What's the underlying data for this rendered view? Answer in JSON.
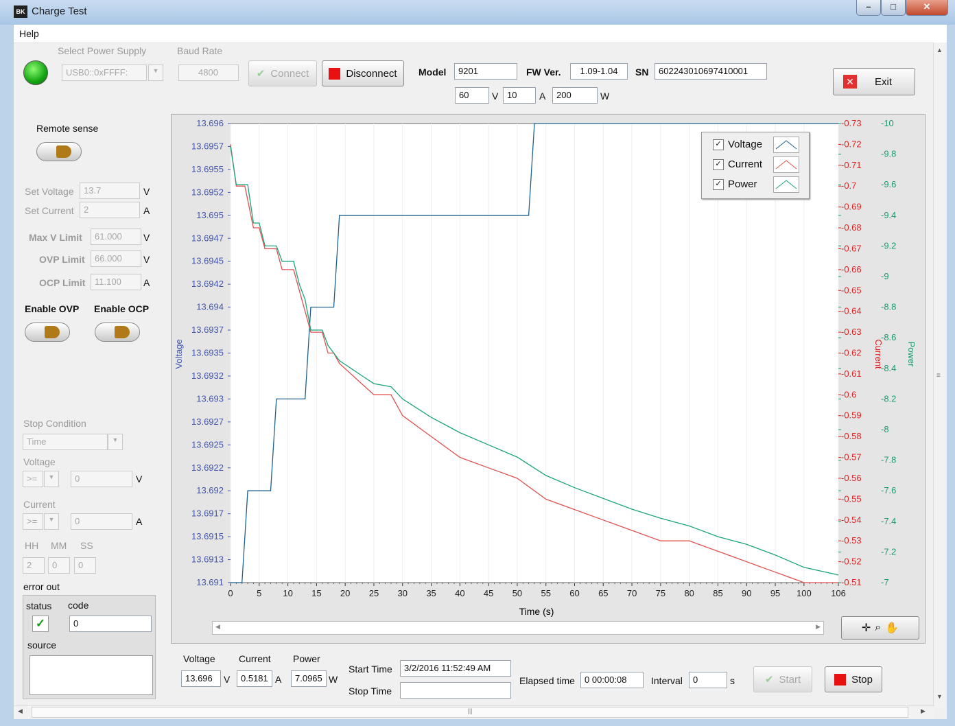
{
  "window": {
    "title": "Charge Test",
    "icon_text": "BK",
    "minimize_glyph": "–",
    "maximize_glyph": "□",
    "close_glyph": "✕"
  },
  "menu": {
    "help": "Help"
  },
  "connection": {
    "select_power_supply_label": "Select Power Supply",
    "power_supply_value": "USB0::0xFFFF:",
    "baud_rate_label": "Baud Rate",
    "baud_rate_value": "4800",
    "connect_label": "Connect",
    "disconnect_label": "Disconnect",
    "status_color": "#14a514"
  },
  "device": {
    "model_label": "Model",
    "model_value": "9201",
    "fw_label": "FW Ver.",
    "fw_value": "1.09-1.04",
    "sn_label": "SN",
    "sn_value": "602243010697410001",
    "rated_v": "60",
    "v_unit": "V",
    "rated_a": "10",
    "a_unit": "A",
    "rated_w": "200",
    "w_unit": "W"
  },
  "exit_label": "Exit",
  "settings": {
    "remote_sense_label": "Remote sense",
    "set_voltage_label": "Set Voltage",
    "set_voltage_value": "13.7",
    "set_voltage_unit": "V",
    "set_current_label": "Set Current",
    "set_current_value": "2",
    "set_current_unit": "A",
    "max_v_label": "Max V Limit",
    "max_v_value": "61.000",
    "max_v_unit": "V",
    "ovp_label": "OVP Limit",
    "ovp_value": "66.000",
    "ovp_unit": "V",
    "ocp_label": "OCP Limit",
    "ocp_value": "11.100",
    "ocp_unit": "A",
    "enable_ovp_label": "Enable OVP",
    "enable_ocp_label": "Enable OCP"
  },
  "stop": {
    "stop_condition_label": "Stop Condition",
    "stop_condition_value": "Time",
    "voltage_label": "Voltage",
    "voltage_op": ">=",
    "voltage_value": "0",
    "voltage_unit": "V",
    "current_label": "Current",
    "current_op": ">=",
    "current_value": "0",
    "current_unit": "A",
    "hh_label": "HH",
    "mm_label": "MM",
    "ss_label": "SS",
    "hh_value": "2",
    "mm_value": "0",
    "ss_value": "0"
  },
  "error": {
    "label": "error out",
    "status_label": "status",
    "code_label": "code",
    "code_value": "0",
    "source_label": "source",
    "status_glyph": "✓"
  },
  "readout": {
    "voltage_label": "Voltage",
    "voltage_value": "13.696",
    "voltage_unit": "V",
    "current_label": "Current",
    "current_value": "0.5181",
    "current_unit": "A",
    "power_label": "Power",
    "power_value": "7.0965",
    "power_unit": "W",
    "start_time_label": "Start Time",
    "start_time_value": "3/2/2016 11:52:49 AM",
    "stop_time_label": "Stop Time",
    "stop_time_value": "",
    "elapsed_label": "Elapsed time",
    "elapsed_value": "0  00:00:08",
    "interval_label": "Interval",
    "interval_value": "0",
    "interval_unit": "s",
    "start_label": "Start",
    "stop_label": "Stop"
  },
  "legend": {
    "voltage": "Voltage",
    "current": "Current",
    "power": "Power",
    "check_glyph": "✓"
  },
  "chart_data": {
    "type": "line",
    "xlabel": "Time (s)",
    "xlim": [
      0,
      106
    ],
    "x_ticks": [
      "0",
      "5",
      "10",
      "15",
      "20",
      "25",
      "30",
      "35",
      "40",
      "45",
      "50",
      "55",
      "60",
      "65",
      "70",
      "75",
      "80",
      "85",
      "90",
      "95",
      "100",
      "106"
    ],
    "y_left": {
      "label": "Voltage",
      "range": [
        13.691,
        13.696
      ],
      "ticks": [
        "13.696",
        "13.6957",
        "13.6955",
        "13.6952",
        "13.695",
        "13.6947",
        "13.6945",
        "13.6942",
        "13.694",
        "13.6937",
        "13.6935",
        "13.6932",
        "13.693",
        "13.6927",
        "13.6925",
        "13.6922",
        "13.692",
        "13.6917",
        "13.6915",
        "13.6913",
        "13.691"
      ],
      "color": "#4455aa"
    },
    "y_right1": {
      "label": "Current",
      "range": [
        -0.73,
        -0.51
      ],
      "ticks": [
        "-0.73",
        "-0.72",
        "-0.71",
        "-0.7",
        "-0.69",
        "-0.68",
        "-0.67",
        "-0.66",
        "-0.65",
        "-0.64",
        "-0.63",
        "-0.62",
        "-0.61",
        "-0.6",
        "-0.59",
        "-0.58",
        "-0.57",
        "-0.56",
        "-0.55",
        "-0.54",
        "-0.53",
        "-0.52",
        "-0.51"
      ],
      "color": "#e02020"
    },
    "y_right2": {
      "label": "Power",
      "range": [
        -10,
        -7
      ],
      "ticks": [
        "-10",
        "-9.8",
        "-9.6",
        "-9.4",
        "-9.2",
        "-9",
        "-8.8",
        "-8.6",
        "-8.4",
        "-8.2",
        "-8",
        "-7.8",
        "-7.6",
        "-7.4",
        "-7.2",
        "-7"
      ],
      "color": "#1a9a6a"
    },
    "series": [
      {
        "name": "Voltage",
        "color": "#1f5f8b",
        "points": [
          [
            0,
            13.691
          ],
          [
            2,
            13.691
          ],
          [
            3,
            13.692
          ],
          [
            7,
            13.692
          ],
          [
            8,
            13.693
          ],
          [
            13,
            13.693
          ],
          [
            14,
            13.694
          ],
          [
            18,
            13.694
          ],
          [
            19,
            13.695
          ],
          [
            52,
            13.695
          ],
          [
            53,
            13.696
          ],
          [
            106,
            13.696
          ]
        ]
      },
      {
        "name": "Current",
        "color": "#e05050",
        "points": [
          [
            0,
            -0.72
          ],
          [
            1,
            -0.7
          ],
          [
            2.5,
            -0.7
          ],
          [
            4,
            -0.68
          ],
          [
            5,
            -0.68
          ],
          [
            6,
            -0.67
          ],
          [
            8,
            -0.67
          ],
          [
            9,
            -0.66
          ],
          [
            11,
            -0.66
          ],
          [
            12,
            -0.65
          ],
          [
            13,
            -0.64
          ],
          [
            14,
            -0.63
          ],
          [
            16,
            -0.63
          ],
          [
            17,
            -0.62
          ],
          [
            18,
            -0.62
          ],
          [
            19,
            -0.615
          ],
          [
            21,
            -0.61
          ],
          [
            23,
            -0.605
          ],
          [
            25,
            -0.6
          ],
          [
            28,
            -0.6
          ],
          [
            30,
            -0.59
          ],
          [
            35,
            -0.58
          ],
          [
            40,
            -0.57
          ],
          [
            45,
            -0.565
          ],
          [
            50,
            -0.56
          ],
          [
            55,
            -0.55
          ],
          [
            60,
            -0.545
          ],
          [
            65,
            -0.54
          ],
          [
            70,
            -0.535
          ],
          [
            75,
            -0.53
          ],
          [
            80,
            -0.53
          ],
          [
            85,
            -0.525
          ],
          [
            90,
            -0.52
          ],
          [
            95,
            -0.515
          ],
          [
            100,
            -0.51
          ],
          [
            106,
            -0.51
          ]
        ]
      },
      {
        "name": "Power",
        "color": "#1aa37a",
        "points": [
          [
            0,
            -9.85
          ],
          [
            1,
            -9.6
          ],
          [
            3,
            -9.6
          ],
          [
            4,
            -9.35
          ],
          [
            5,
            -9.35
          ],
          [
            6,
            -9.2
          ],
          [
            8,
            -9.2
          ],
          [
            9,
            -9.1
          ],
          [
            11,
            -9.1
          ],
          [
            12,
            -8.95
          ],
          [
            13,
            -8.85
          ],
          [
            14,
            -8.65
          ],
          [
            16,
            -8.65
          ],
          [
            17,
            -8.55
          ],
          [
            18,
            -8.5
          ],
          [
            19,
            -8.45
          ],
          [
            21,
            -8.4
          ],
          [
            23,
            -8.35
          ],
          [
            25,
            -8.3
          ],
          [
            28,
            -8.28
          ],
          [
            30,
            -8.2
          ],
          [
            35,
            -8.08
          ],
          [
            40,
            -7.98
          ],
          [
            45,
            -7.9
          ],
          [
            50,
            -7.82
          ],
          [
            55,
            -7.7
          ],
          [
            60,
            -7.62
          ],
          [
            65,
            -7.55
          ],
          [
            70,
            -7.48
          ],
          [
            75,
            -7.42
          ],
          [
            80,
            -7.37
          ],
          [
            85,
            -7.3
          ],
          [
            90,
            -7.25
          ],
          [
            95,
            -7.18
          ],
          [
            100,
            -7.1
          ],
          [
            106,
            -7.05
          ]
        ]
      }
    ]
  }
}
